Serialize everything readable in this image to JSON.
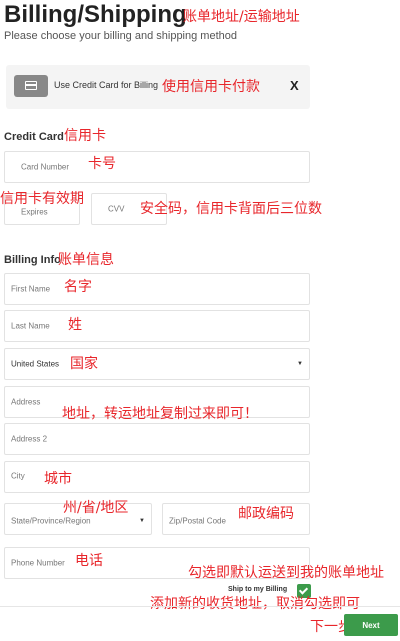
{
  "header": {
    "title": "Billing/Shipping",
    "subtitle": "Please choose your billing and shipping method"
  },
  "payment_method": {
    "card_icon": "credit-card-icon",
    "label": "Use Credit Card for Billing",
    "close": "X"
  },
  "credit_card": {
    "heading": "Credit Card",
    "card_number_placeholder": "Card Number",
    "expires_placeholder": "Expires",
    "cvv_placeholder": "CVV"
  },
  "billing_info": {
    "heading": "Billing Info",
    "first_name_placeholder": "First Name",
    "last_name_placeholder": "Last Name",
    "country_value": "United States",
    "address_placeholder": "Address",
    "address2_placeholder": "Address 2",
    "city_placeholder": "City",
    "state_placeholder": "State/Province/Region",
    "postal_placeholder": "Zip/Postal Code",
    "phone_placeholder": "Phone Number"
  },
  "footer": {
    "ship_to_billing_label": "Ship to my Billing",
    "ship_to_billing_checked": true,
    "next_label": "Next"
  },
  "annotations": {
    "title_note": "账单地址/运输地址",
    "payment_note": "使用信用卡付款",
    "credit_card_note": "信用卡",
    "card_number_note": "卡号",
    "expires_note": "信用卡有效期",
    "cvv_note": "安全码，信用卡背面后三位数",
    "billing_info_note": "账单信息",
    "first_name_note": "名字",
    "last_name_note": "姓",
    "country_note": "国家",
    "address_note": "地址，转运地址复制过来即可！",
    "city_note": "城市",
    "state_note": "州/省/地区",
    "postal_note": "邮政编码",
    "phone_note": "电话",
    "ship_default_note": "勾选即默认运送到我的账单地址",
    "ship_new_note": "添加新的收货地址，取消勾选即可",
    "next_note": "下一步"
  },
  "colors": {
    "accent_green": "#3c9b4b",
    "annotation_red": "#e8262b",
    "card_button_gray": "#888888"
  }
}
